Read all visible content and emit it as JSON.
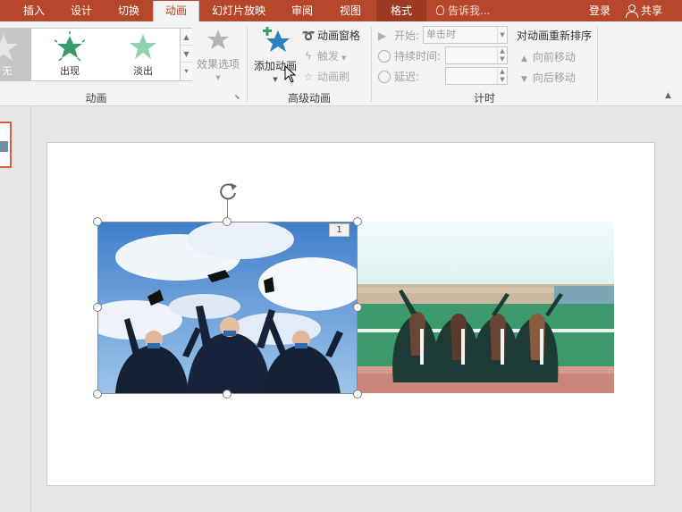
{
  "tabs": [
    {
      "label": "插入",
      "active": false
    },
    {
      "label": "设计",
      "active": false
    },
    {
      "label": "切换",
      "active": false
    },
    {
      "label": "动画",
      "active": true
    },
    {
      "label": "幻灯片放映",
      "active": false
    },
    {
      "label": "审阅",
      "active": false
    },
    {
      "label": "视图",
      "active": false
    },
    {
      "label": "格式",
      "active": false
    }
  ],
  "tell_me": "告诉我...",
  "login": "登录",
  "share": "共享",
  "gallery": {
    "items": [
      {
        "label": "无",
        "icon": "star-none-icon"
      },
      {
        "label": "出现",
        "icon": "star-appear-icon"
      },
      {
        "label": "淡出",
        "icon": "star-fade-icon"
      }
    ]
  },
  "effect_options": "效果选项",
  "group_animation": "动画",
  "add_animation": "添加动画",
  "animation_pane": "动画窗格",
  "trigger": "触发",
  "animation_painter": "动画刷",
  "group_advanced": "高级动画",
  "timing": {
    "start_label": "开始:",
    "start_value": "单击时",
    "duration_label": "持续时间:",
    "delay_label": "延迟:",
    "group_label": "计时"
  },
  "reorder": {
    "title": "对动画重新排序",
    "move_earlier": "向前移动",
    "move_later": "向后移动"
  },
  "slide": {
    "animation_number": "1"
  },
  "colors": {
    "accent": "#b7472a",
    "star_green": "#3a9b6a"
  }
}
